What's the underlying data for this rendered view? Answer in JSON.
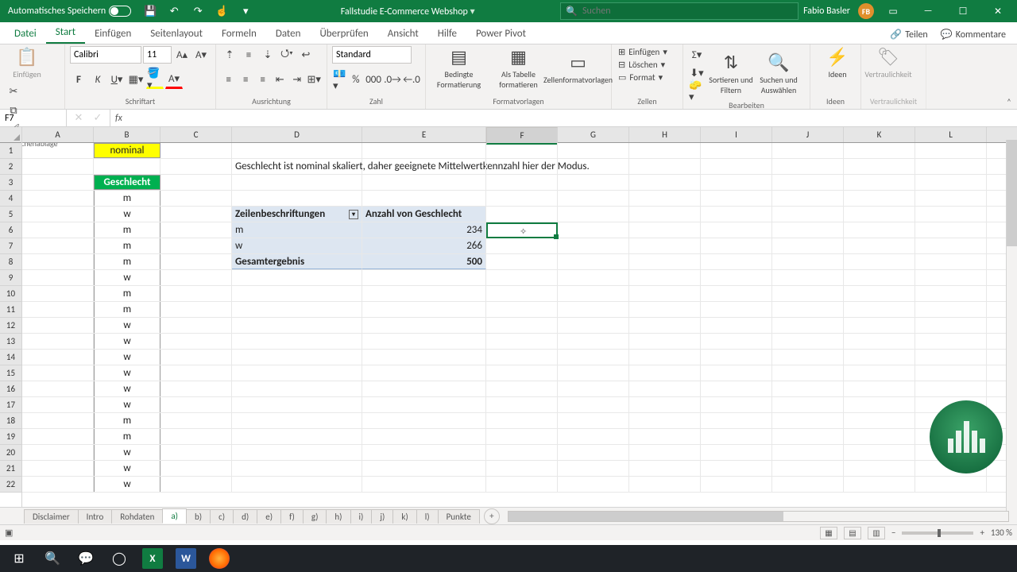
{
  "title": {
    "autosave": "Automatisches Speichern",
    "filename": "Fallstudie E-Commerce Webshop",
    "search_ph": "Suchen",
    "user": "Fabio Basler",
    "initials": "FB"
  },
  "tabs": {
    "file": "Datei",
    "start": "Start",
    "einf": "Einfügen",
    "layout": "Seitenlayout",
    "form": "Formeln",
    "data": "Daten",
    "review": "Überprüfen",
    "view": "Ansicht",
    "help": "Hilfe",
    "pp": "Power Pivot",
    "share": "Teilen",
    "comments": "Kommentare"
  },
  "ribbon": {
    "clipboard": {
      "paste": "Einfügen",
      "label": "Zwischenablage"
    },
    "font": {
      "name": "Calibri",
      "size": "11",
      "label": "Schriftart"
    },
    "align": {
      "label": "Ausrichtung"
    },
    "number": {
      "fmt": "Standard",
      "label": "Zahl"
    },
    "styles": {
      "cond": "Bedingte\nFormatierung",
      "tbl": "Als Tabelle\nformatieren",
      "cell": "Zellenformatvorlagen",
      "label": "Formatvorlagen"
    },
    "cells": {
      "ins": "Einfügen",
      "del": "Löschen",
      "fmt": "Format",
      "label": "Zellen"
    },
    "edit": {
      "sort": "Sortieren und\nFiltern",
      "find": "Suchen und\nAuswählen",
      "label": "Bearbeiten"
    },
    "ideas": {
      "lbl": "Ideen",
      "group": "Ideen"
    },
    "sens": {
      "lbl": "Vertraulichkeit",
      "group": "Vertraulichkeit"
    }
  },
  "namebox": "F7",
  "columns": [
    "A",
    "B",
    "C",
    "D",
    "E",
    "F",
    "G",
    "H",
    "I",
    "J",
    "K",
    "L"
  ],
  "rows": [
    "1",
    "2",
    "3",
    "4",
    "5",
    "6",
    "7",
    "8",
    "9",
    "10",
    "11",
    "12",
    "13",
    "14",
    "15",
    "16",
    "17",
    "18",
    "19",
    "20",
    "21",
    "22"
  ],
  "cells": {
    "B1": "nominal",
    "D2": "Geschlecht ist nominal skaliert, daher geeignete Mittelwertkennzahl hier der Modus.",
    "B3": "Geschlecht",
    "Bdata": [
      "m",
      "w",
      "m",
      "m",
      "m",
      "w",
      "m",
      "m",
      "w",
      "w",
      "w",
      "w",
      "w",
      "w",
      "m",
      "m",
      "w",
      "w",
      "w"
    ],
    "D5": "Zeilenbeschriftungen",
    "E5": "Anzahl von Geschlecht",
    "D6": "m",
    "E6": "234",
    "D7": "w",
    "E7": "266",
    "D8": "Gesamtergebnis",
    "E8": "500"
  },
  "sheets": [
    "Disclaimer",
    "Intro",
    "Rohdaten",
    "a)",
    "b)",
    "c)",
    "d)",
    "e)",
    "f)",
    "g)",
    "h)",
    "i)",
    "j)",
    "k)",
    "l)",
    "Punkte"
  ],
  "active_sheet": "a)",
  "zoom": "130 %",
  "chart_data": {
    "type": "table",
    "title": "Anzahl von Geschlecht",
    "categories": [
      "m",
      "w",
      "Gesamtergebnis"
    ],
    "values": [
      234,
      266,
      500
    ]
  }
}
